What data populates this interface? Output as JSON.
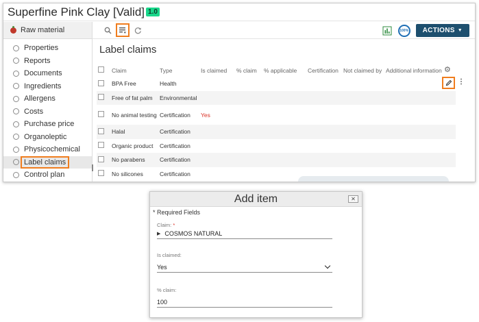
{
  "window": {
    "title": "Superfine Pink Clay [Valid]",
    "version": "1.0"
  },
  "sidebar": {
    "header": "Raw material",
    "items": [
      {
        "label": "Properties"
      },
      {
        "label": "Reports"
      },
      {
        "label": "Documents"
      },
      {
        "label": "Ingredients"
      },
      {
        "label": "Allergens"
      },
      {
        "label": "Costs"
      },
      {
        "label": "Purchase price"
      },
      {
        "label": "Organoleptic"
      },
      {
        "label": "Physicochemical"
      },
      {
        "label": "Label claims"
      },
      {
        "label": "Control plan"
      }
    ],
    "active_index": 9
  },
  "toolbar": {
    "icons": [
      "search-icon",
      "list-filter-icon",
      "refresh-icon"
    ],
    "score": "100%",
    "actions_label": "ACTIONS"
  },
  "main": {
    "title": "Label claims",
    "columns": [
      "Claim",
      "Type",
      "Is claimed",
      "% claim",
      "% applicable",
      "Certification",
      "Not claimed by",
      "Additional information"
    ],
    "rows": [
      {
        "claim": "BPA Free",
        "type": "Health",
        "is_claimed": ""
      },
      {
        "claim": "Free of fat palm",
        "type": "Environmental",
        "is_claimed": ""
      },
      {
        "claim": "No animal testing",
        "type": "Certification",
        "is_claimed": "Yes"
      },
      {
        "claim": "Halal",
        "type": "Certification",
        "is_claimed": ""
      },
      {
        "claim": "Organic product",
        "type": "Certification",
        "is_claimed": ""
      },
      {
        "claim": "No parabens",
        "type": "Certification",
        "is_claimed": ""
      },
      {
        "claim": "No silicones",
        "type": "Certification",
        "is_claimed": ""
      }
    ]
  },
  "dialog": {
    "title": "Add item",
    "close": "✕",
    "required_note": "* Required Fields",
    "claim_label": "Claim:",
    "claim_required": "*",
    "claim_value": "COSMOS NATURAL",
    "is_claimed_label": "Is claimed:",
    "is_claimed_value": "Yes",
    "percent_claim_label": "% claim:",
    "percent_claim_value": "100"
  },
  "colors": {
    "highlight": "#f07d1e",
    "actions_button": "#1d4f6e",
    "version_badge": "#19d78a",
    "claimed_yes": "#d93025"
  }
}
